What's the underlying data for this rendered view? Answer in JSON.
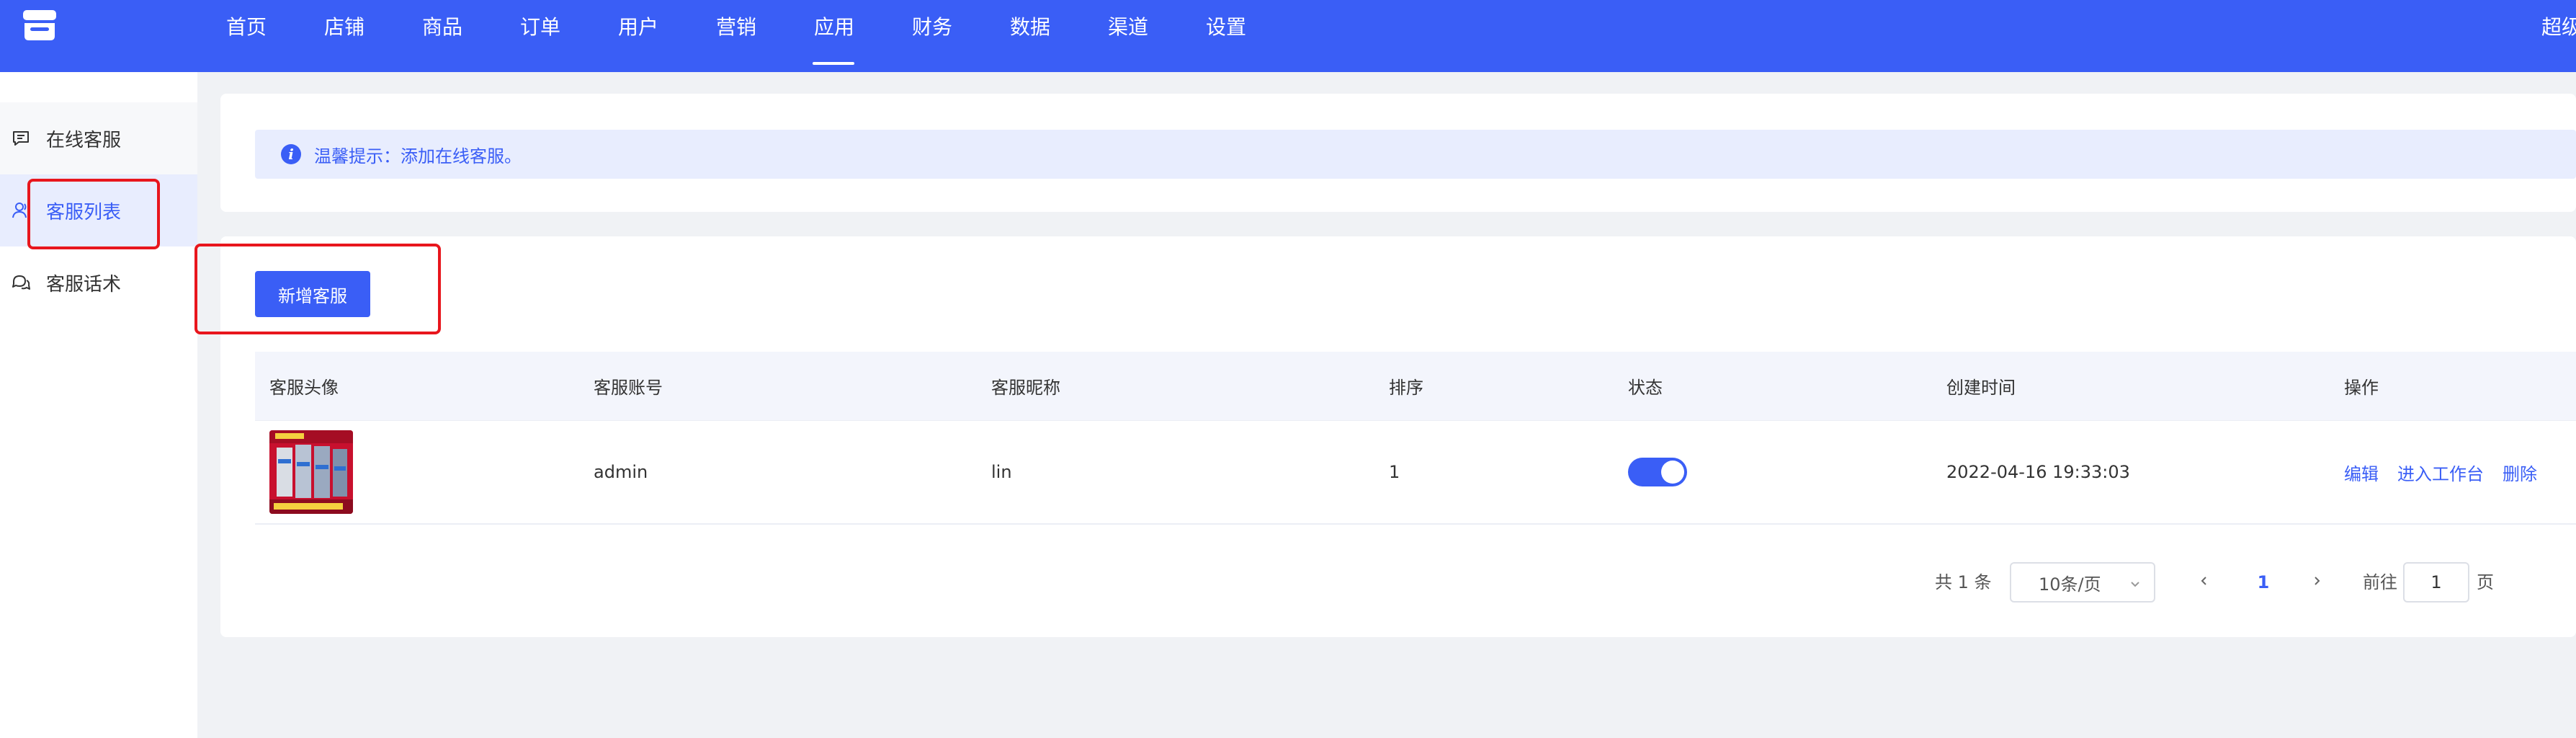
{
  "nav": {
    "items": [
      {
        "label": "首页"
      },
      {
        "label": "店铺"
      },
      {
        "label": "商品"
      },
      {
        "label": "订单"
      },
      {
        "label": "用户"
      },
      {
        "label": "营销"
      },
      {
        "label": "应用",
        "active": true
      },
      {
        "label": "财务"
      },
      {
        "label": "数据"
      },
      {
        "label": "渠道"
      },
      {
        "label": "设置"
      }
    ],
    "user_label": "超级"
  },
  "sidebar": {
    "items": [
      {
        "label": "在线客服",
        "icon": "chat-square-icon"
      },
      {
        "label": "客服列表",
        "icon": "user-icon",
        "active": true
      },
      {
        "label": "客服话术",
        "icon": "chat-bubbles-icon"
      }
    ]
  },
  "tip": {
    "text": "温馨提示：添加在线客服。"
  },
  "toolbar": {
    "add_label": "新增客服"
  },
  "table": {
    "headers": {
      "avatar": "客服头像",
      "account": "客服账号",
      "nickname": "客服昵称",
      "sort": "排序",
      "status": "状态",
      "created": "创建时间",
      "actions": "操作"
    },
    "rows": [
      {
        "account": "admin",
        "nickname": "lin",
        "sort": "1",
        "status_on": true,
        "created": "2022-04-16 19:33:03",
        "actions": {
          "edit": "编辑",
          "workbench": "进入工作台",
          "delete": "删除"
        }
      }
    ]
  },
  "pagination": {
    "total_label": "共 1 条",
    "page_size_label": "10条/页",
    "current_page": "1",
    "goto_label": "前往",
    "goto_value": "1",
    "page_unit": "页"
  },
  "colors": {
    "primary": "#3a5ef6",
    "annotation": "#e8161d",
    "background": "#f0f2f5"
  }
}
